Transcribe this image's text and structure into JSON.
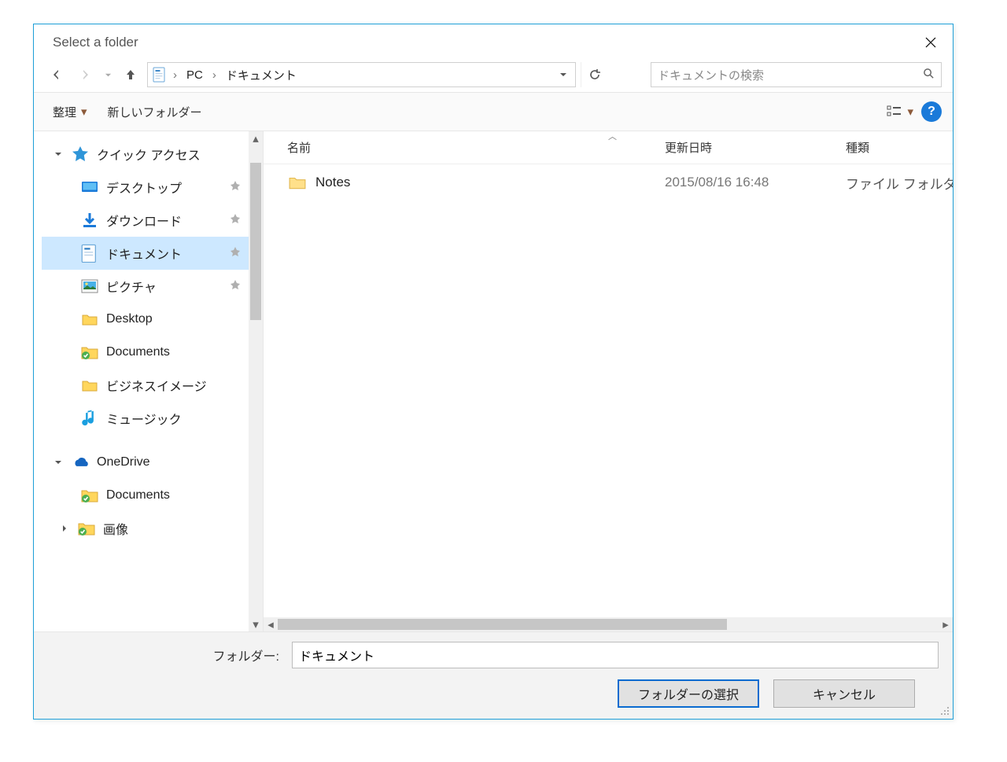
{
  "dialog": {
    "title": "Select a folder"
  },
  "address": {
    "root": "PC",
    "folder": "ドキュメント"
  },
  "search": {
    "placeholder": "ドキュメントの検索"
  },
  "toolbar": {
    "organize": "整理",
    "newFolder": "新しいフォルダー"
  },
  "tree": {
    "quickAccess": "クイック アクセス",
    "desktop": "デスクトップ",
    "downloads": "ダウンロード",
    "documents": "ドキュメント",
    "pictures": "ピクチャ",
    "desktopEn": "Desktop",
    "documentsEn": "Documents",
    "business": "ビジネスイメージ",
    "music": "ミュージック",
    "onedrive": "OneDrive",
    "odDocuments": "Documents",
    "odImages": "画像"
  },
  "columns": {
    "name": "名前",
    "date": "更新日時",
    "type": "種類"
  },
  "rows": [
    {
      "name": "Notes",
      "date": "2015/08/16 16:48",
      "type": "ファイル フォルダ"
    }
  ],
  "footer": {
    "folderLabel": "フォルダー:",
    "folderValue": "ドキュメント",
    "select": "フォルダーの選択",
    "cancel": "キャンセル"
  }
}
